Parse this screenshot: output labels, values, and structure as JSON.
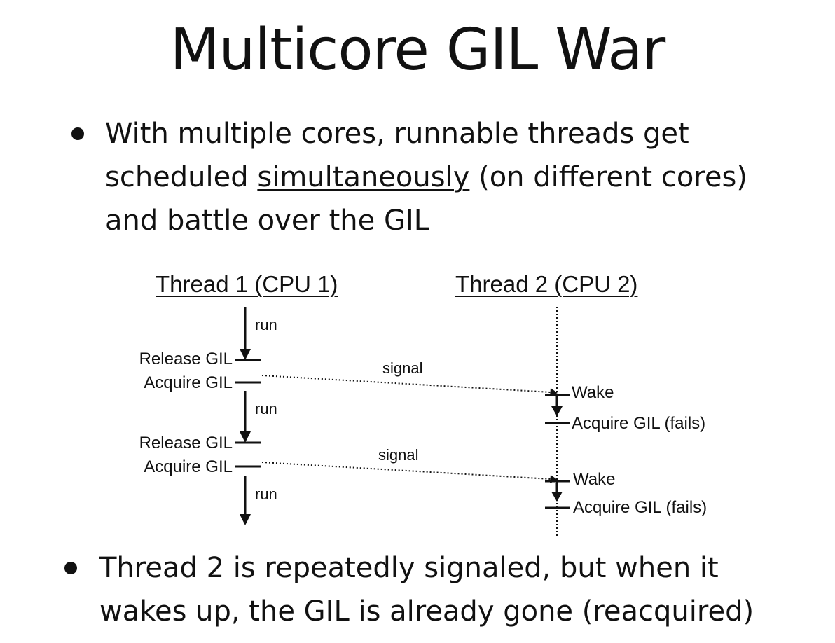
{
  "slide": {
    "title": "Multicore GIL War",
    "bullet_1": {
      "line_1": "With multiple cores, runnable threads get",
      "line_2_before": "scheduled ",
      "line_2_underlined": "simultaneously",
      "line_2_after": " (on different cores)",
      "line_3": "and battle over the GIL"
    },
    "bullet_2": {
      "line_1": "Thread 2 is repeatedly signaled, but when it",
      "line_2": "wakes up, the GIL is already gone (reacquired)"
    }
  },
  "diagram": {
    "thread_1_header": "Thread 1 (CPU 1)",
    "thread_2_header": "Thread 2 (CPU 2)",
    "run_label": "run",
    "release_gil": "Release GIL",
    "acquire_gil": "Acquire GIL",
    "signal_label": "signal",
    "wake_label": "Wake",
    "acquire_gil_fails": "Acquire GIL (fails)"
  }
}
